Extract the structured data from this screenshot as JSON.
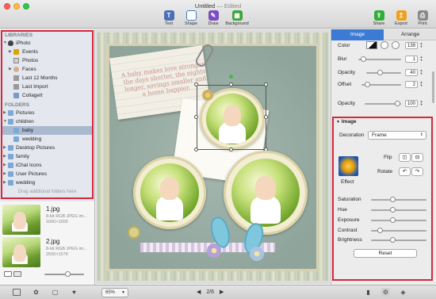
{
  "window": {
    "title": "Untitled",
    "edited": "— Edited"
  },
  "toolbar": {
    "left": [
      {
        "label": "Text",
        "icon": "text-icon",
        "color": "#4a6fb5"
      },
      {
        "label": "Shape",
        "icon": "shape-icon",
        "color": "#3c7bd4"
      },
      {
        "label": "Draw",
        "icon": "draw-icon",
        "color": "#7a4fc4"
      },
      {
        "label": "Background",
        "icon": "background-icon",
        "color": "#3aa53a"
      }
    ],
    "right": [
      {
        "label": "Share",
        "icon": "share-icon",
        "color": "#2fae3a"
      },
      {
        "label": "Export",
        "icon": "export-icon",
        "color": "#f0a020"
      },
      {
        "label": "Print",
        "icon": "print-icon",
        "color": "#777777"
      }
    ]
  },
  "sidebar": {
    "libraries_heading": "LIBRARIES",
    "libraries": [
      {
        "label": "iPhoto",
        "icon": "iphoto-icon",
        "indent": 0
      },
      {
        "label": "Events",
        "icon": "events-icon",
        "indent": 1
      },
      {
        "label": "Photos",
        "icon": "photos-icon",
        "indent": 1
      },
      {
        "label": "Faces",
        "icon": "faces-icon",
        "indent": 1
      },
      {
        "label": "Last 12 Months",
        "icon": "smart-album-icon",
        "indent": 1
      },
      {
        "label": "Last Import",
        "icon": "import-icon",
        "indent": 1
      },
      {
        "label": "CollageIt",
        "icon": "album-icon",
        "indent": 1
      }
    ],
    "folders_heading": "FOLDERS",
    "folders": [
      {
        "label": "Pictures",
        "indent": 0,
        "selected": false
      },
      {
        "label": "children",
        "indent": 0,
        "selected": false
      },
      {
        "label": "baby",
        "indent": 1,
        "selected": true
      },
      {
        "label": "wedding",
        "indent": 1,
        "selected": false
      },
      {
        "label": "Desktop Pictures",
        "indent": 0,
        "selected": false
      },
      {
        "label": "family",
        "indent": 0,
        "selected": false
      },
      {
        "label": "iChat Icons",
        "indent": 0,
        "selected": false
      },
      {
        "label": "User Pictures",
        "indent": 0,
        "selected": false
      },
      {
        "label": "wedding",
        "indent": 0,
        "selected": false
      }
    ],
    "drag_hint": "Drag additional folders here"
  },
  "thumbnails": [
    {
      "name": "1.jpg",
      "type": "8-bit RGB JPEG im...",
      "size": "1600×1000"
    },
    {
      "name": "2.jpg",
      "type": "8-bit RGB JPEG im...",
      "size": "2500×1579"
    }
  ],
  "canvas": {
    "note_text": "A baby makes love stronger, the days shorter, the nights longer, savings smaller and a home happier."
  },
  "bottombar": {
    "zoom": "65%",
    "page": "2/6"
  },
  "inspector": {
    "tabs": [
      "Image",
      "Arrange"
    ],
    "active_tab": "Image",
    "color_label": "Color",
    "color_value": "139",
    "blur_label": "Blur",
    "blur_value": "1",
    "opacity_label": "Opacity",
    "opacity_value": "40",
    "offset_label": "Offset",
    "offset_value": "2",
    "opacity2_label": "Opacity",
    "opacity2_value": "100",
    "image_section": "Image",
    "decoration_label": "Decoration",
    "decoration_value": "Frame",
    "flip_label": "Flip",
    "rotate_label": "Rotate",
    "effect_label": "Effect",
    "adjust": [
      "Saturation",
      "Hue",
      "Exposure",
      "Contrast",
      "Brightness"
    ],
    "reset_label": "Reset"
  }
}
